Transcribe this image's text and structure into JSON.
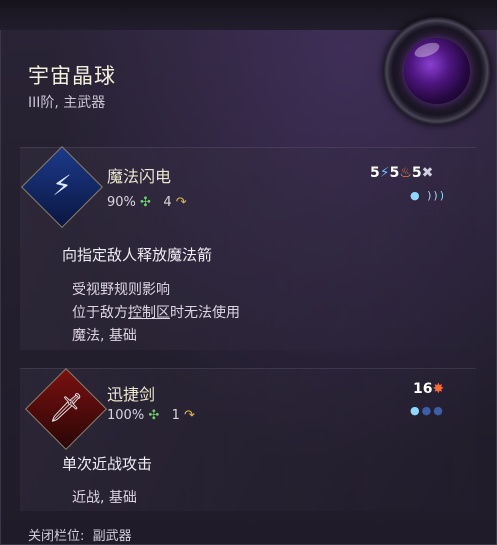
{
  "item": {
    "title": "宇宙晶球",
    "subtitle": "III阶, 主武器"
  },
  "skills": [
    {
      "name": "魔法闪电",
      "accuracy": "90%",
      "accuracy_icon": "target-icon",
      "uses": "4",
      "uses_icon": "swirl-icon",
      "cost_ap": "5",
      "cost_mana": "5",
      "cost_fire": "5",
      "cost_icons": [
        "bolt-icon",
        "fire-icon",
        "cross-icon"
      ],
      "range_dots": "●  ))))",
      "description": "向指定敌人释放魔法箭",
      "notes": [
        "受视野规则影响",
        "位于敌方控制区时无法使用",
        "魔法, 基础"
      ],
      "notes_underline": "控制区"
    },
    {
      "name": "迅捷剑",
      "accuracy": "100%",
      "accuracy_icon": "target-icon",
      "uses": "1",
      "uses_icon": "swirl-icon",
      "cost_ap": "16",
      "cost_icons": [
        "burst-icon"
      ],
      "range_dots": "●○○",
      "description": "单次近战攻击",
      "notes": [
        "近战, 基础"
      ]
    }
  ],
  "footer": {
    "label": "关闭栏位:",
    "value": "副武器"
  },
  "colors": {
    "accent_gold": "#ece6cf",
    "accuracy_green": "#6fd06a",
    "blue": "#6fb6ff",
    "orange": "#ff8a3a"
  }
}
